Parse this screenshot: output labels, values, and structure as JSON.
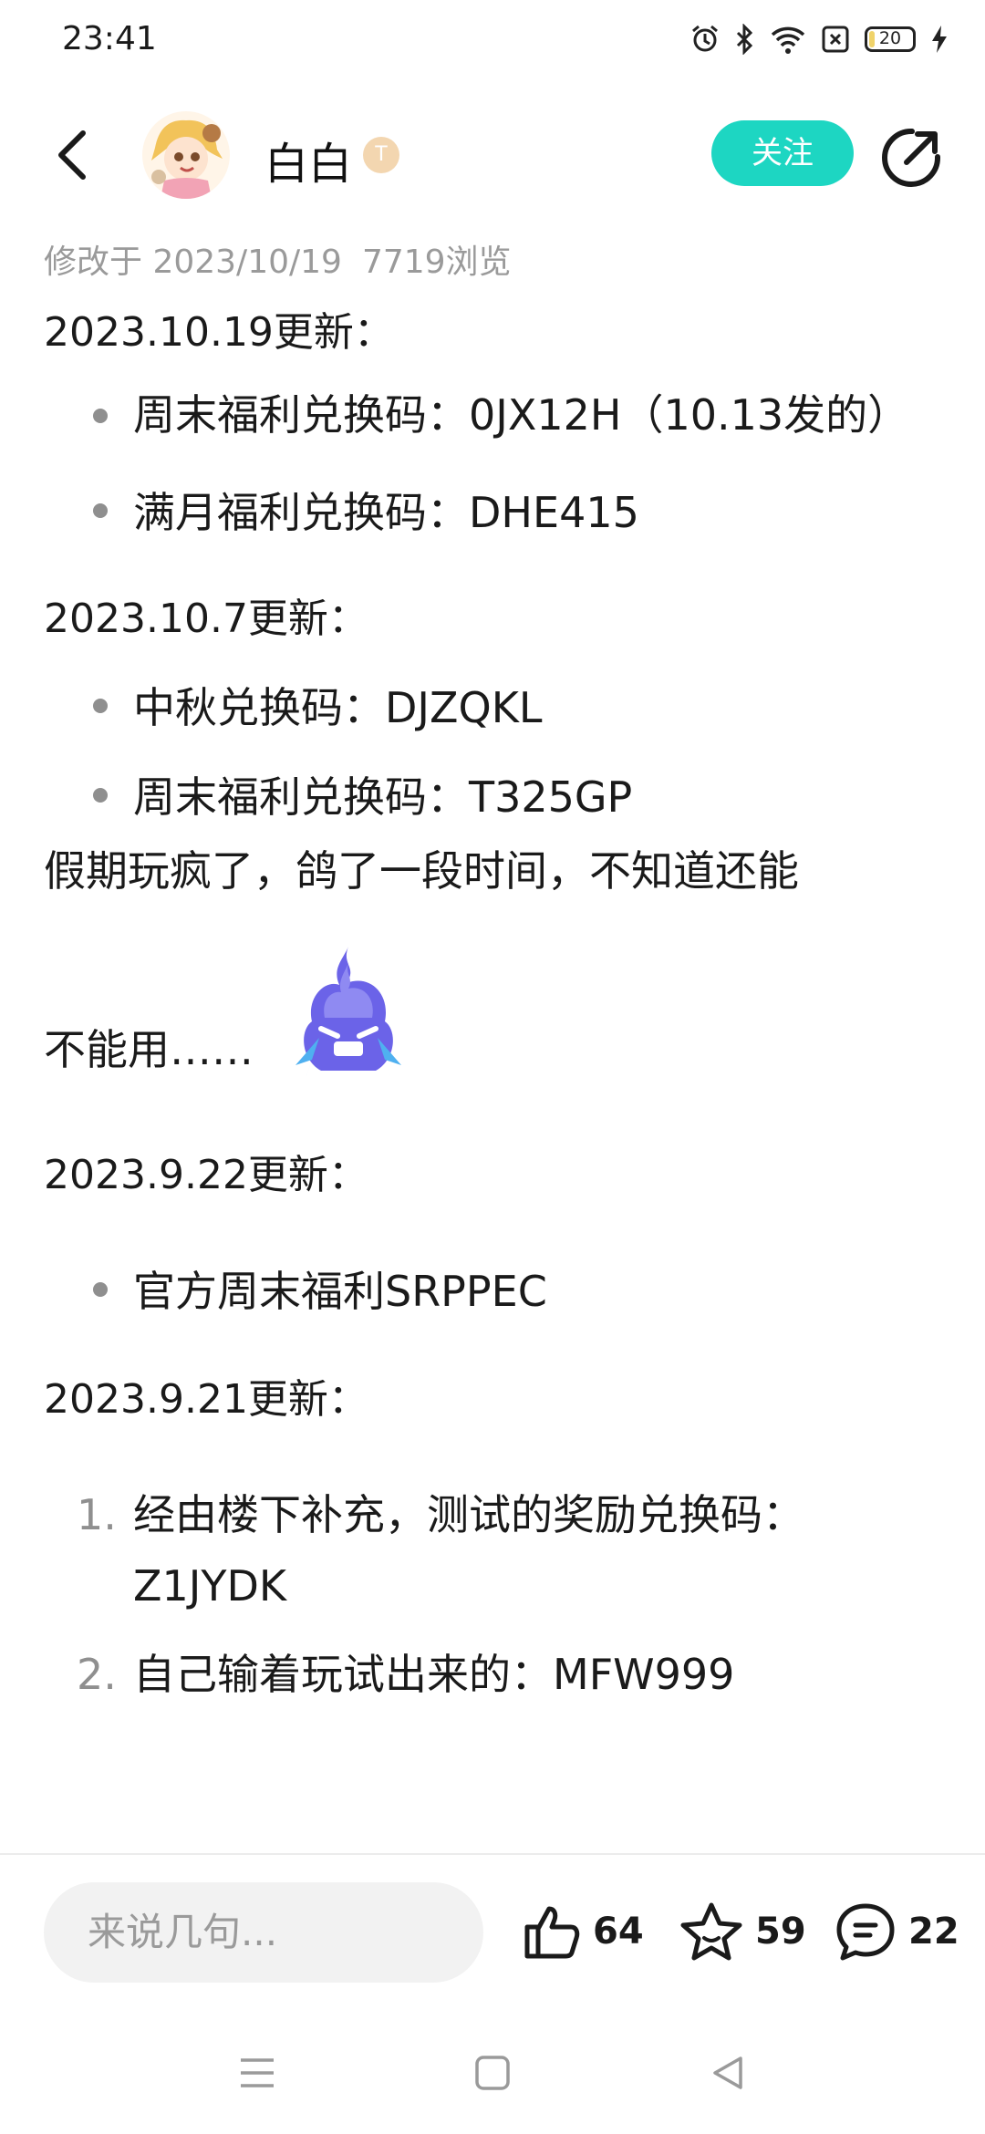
{
  "status_bar": {
    "time": "23:41",
    "battery_level": "20",
    "battery_fraction": 0.2,
    "icons": [
      "alarm-icon",
      "bluetooth-icon",
      "wifi-icon",
      "sim-x-icon",
      "battery-icon",
      "charging-bolt-icon"
    ]
  },
  "header": {
    "author_name": "白白",
    "badge_text": "T",
    "follow_label": "关注",
    "icons": [
      "back-arrow-icon",
      "avatar-image",
      "share-icon"
    ]
  },
  "meta": {
    "modified": "修改于 2023/10/19",
    "views": "7719浏览"
  },
  "content": {
    "sec1_heading": "2023.10.19更新：",
    "sec1_items": [
      "周末福利兑换码：0JX12H（10.13发的）",
      "满月福利兑换码：DHE415"
    ],
    "sec2_heading": "2023.10.7更新：",
    "sec2_items": [
      "中秋兑换码：DJZQKL",
      "周末福利兑换码：T325GP"
    ],
    "para_line1": "假期玩疯了，鸽了一段时间，不知道还能",
    "para_line2": "不能用……",
    "sec3_heading": "2023.9.22更新：",
    "sec3_items": [
      "官方周末福利SRPPEC"
    ],
    "sec4_heading": "2023.9.21更新：",
    "sec4_items": [
      {
        "marker": "1.",
        "text": "经由楼下补充，测试的奖励兑换码：Z1JYDK"
      },
      {
        "marker": "2.",
        "text": "自己输着玩试出来的：MFW999"
      }
    ]
  },
  "bottom_bar": {
    "comment_placeholder": "来说几句...",
    "like_count": "64",
    "favorite_count": "59",
    "comment_count": "22"
  },
  "colors": {
    "accent": "#1dd6c2",
    "meta_text": "#9a9a9a",
    "emoji_flame": "#6b63e8"
  }
}
